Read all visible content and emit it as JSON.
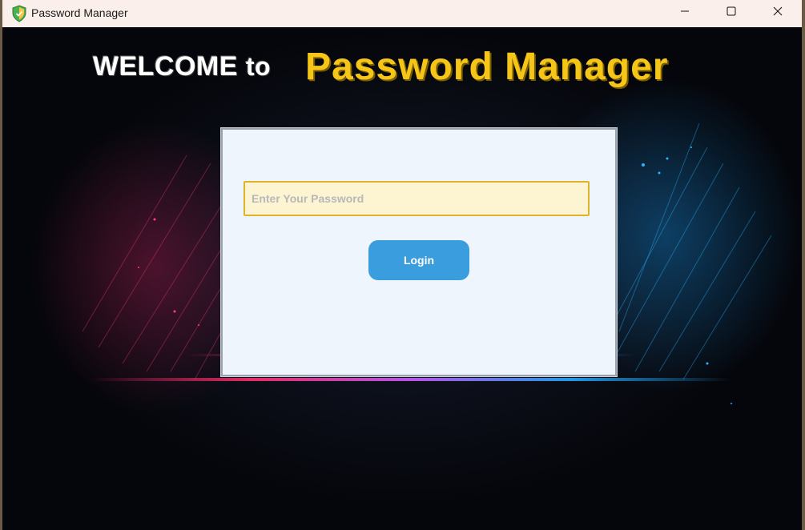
{
  "window": {
    "title": "Password Manager",
    "app_icon": "shield-icon",
    "controls": {
      "minimize_icon": "minimize-icon",
      "maximize_icon": "maximize-icon",
      "close_icon": "close-icon"
    }
  },
  "header": {
    "welcome": "WELCOME",
    "to": "to",
    "brand": "Password Manager"
  },
  "login": {
    "password_placeholder": "Enter Your Password",
    "password_value": "",
    "login_label": "Login"
  },
  "colors": {
    "title_bar": "#fbefeb",
    "brand_text": "#f5c518",
    "panel_bg": "#eef5fc",
    "field_bg": "#fdf5d2",
    "field_border": "#e0b22a",
    "button_bg": "#3a9ddd"
  }
}
